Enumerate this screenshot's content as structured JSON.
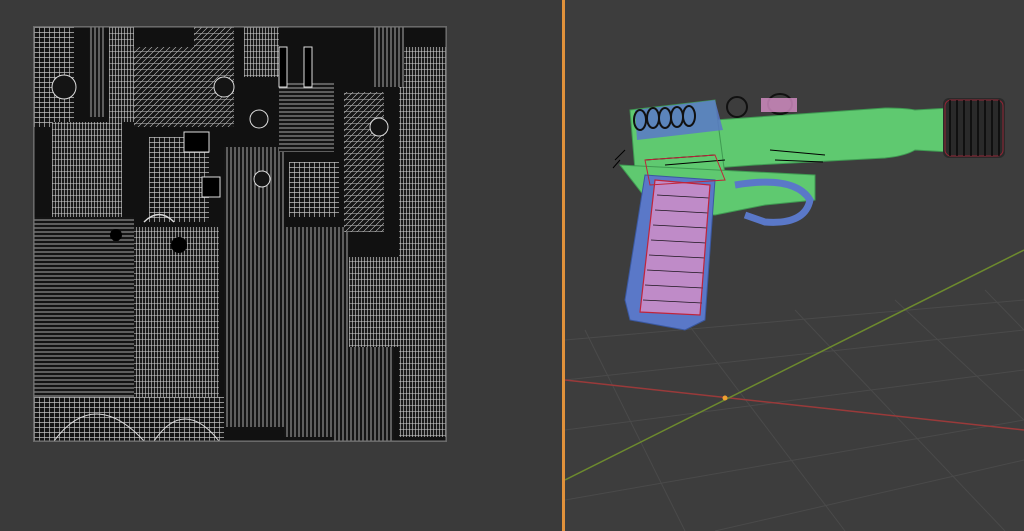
{
  "uv_editor": {
    "panel": "uv-editor",
    "content": "uv-island-wireframe-grid"
  },
  "viewport": {
    "panel": "3d-viewport",
    "object": "pistol-with-suppressor",
    "colors": {
      "background": "#3d3d3d",
      "grid": "#4a4a4a",
      "x_axis": "#9a3a3a",
      "y_axis": "#6d8a2e",
      "origin": "#f0a030",
      "mesh_green": "#5fc970",
      "mesh_blue": "#5a78c8",
      "selection": "#c0243a"
    }
  },
  "colors": {
    "splitter": "#e0913b",
    "uv_background": "#3a3a3a",
    "uv_wire": "#d9d9d9"
  }
}
